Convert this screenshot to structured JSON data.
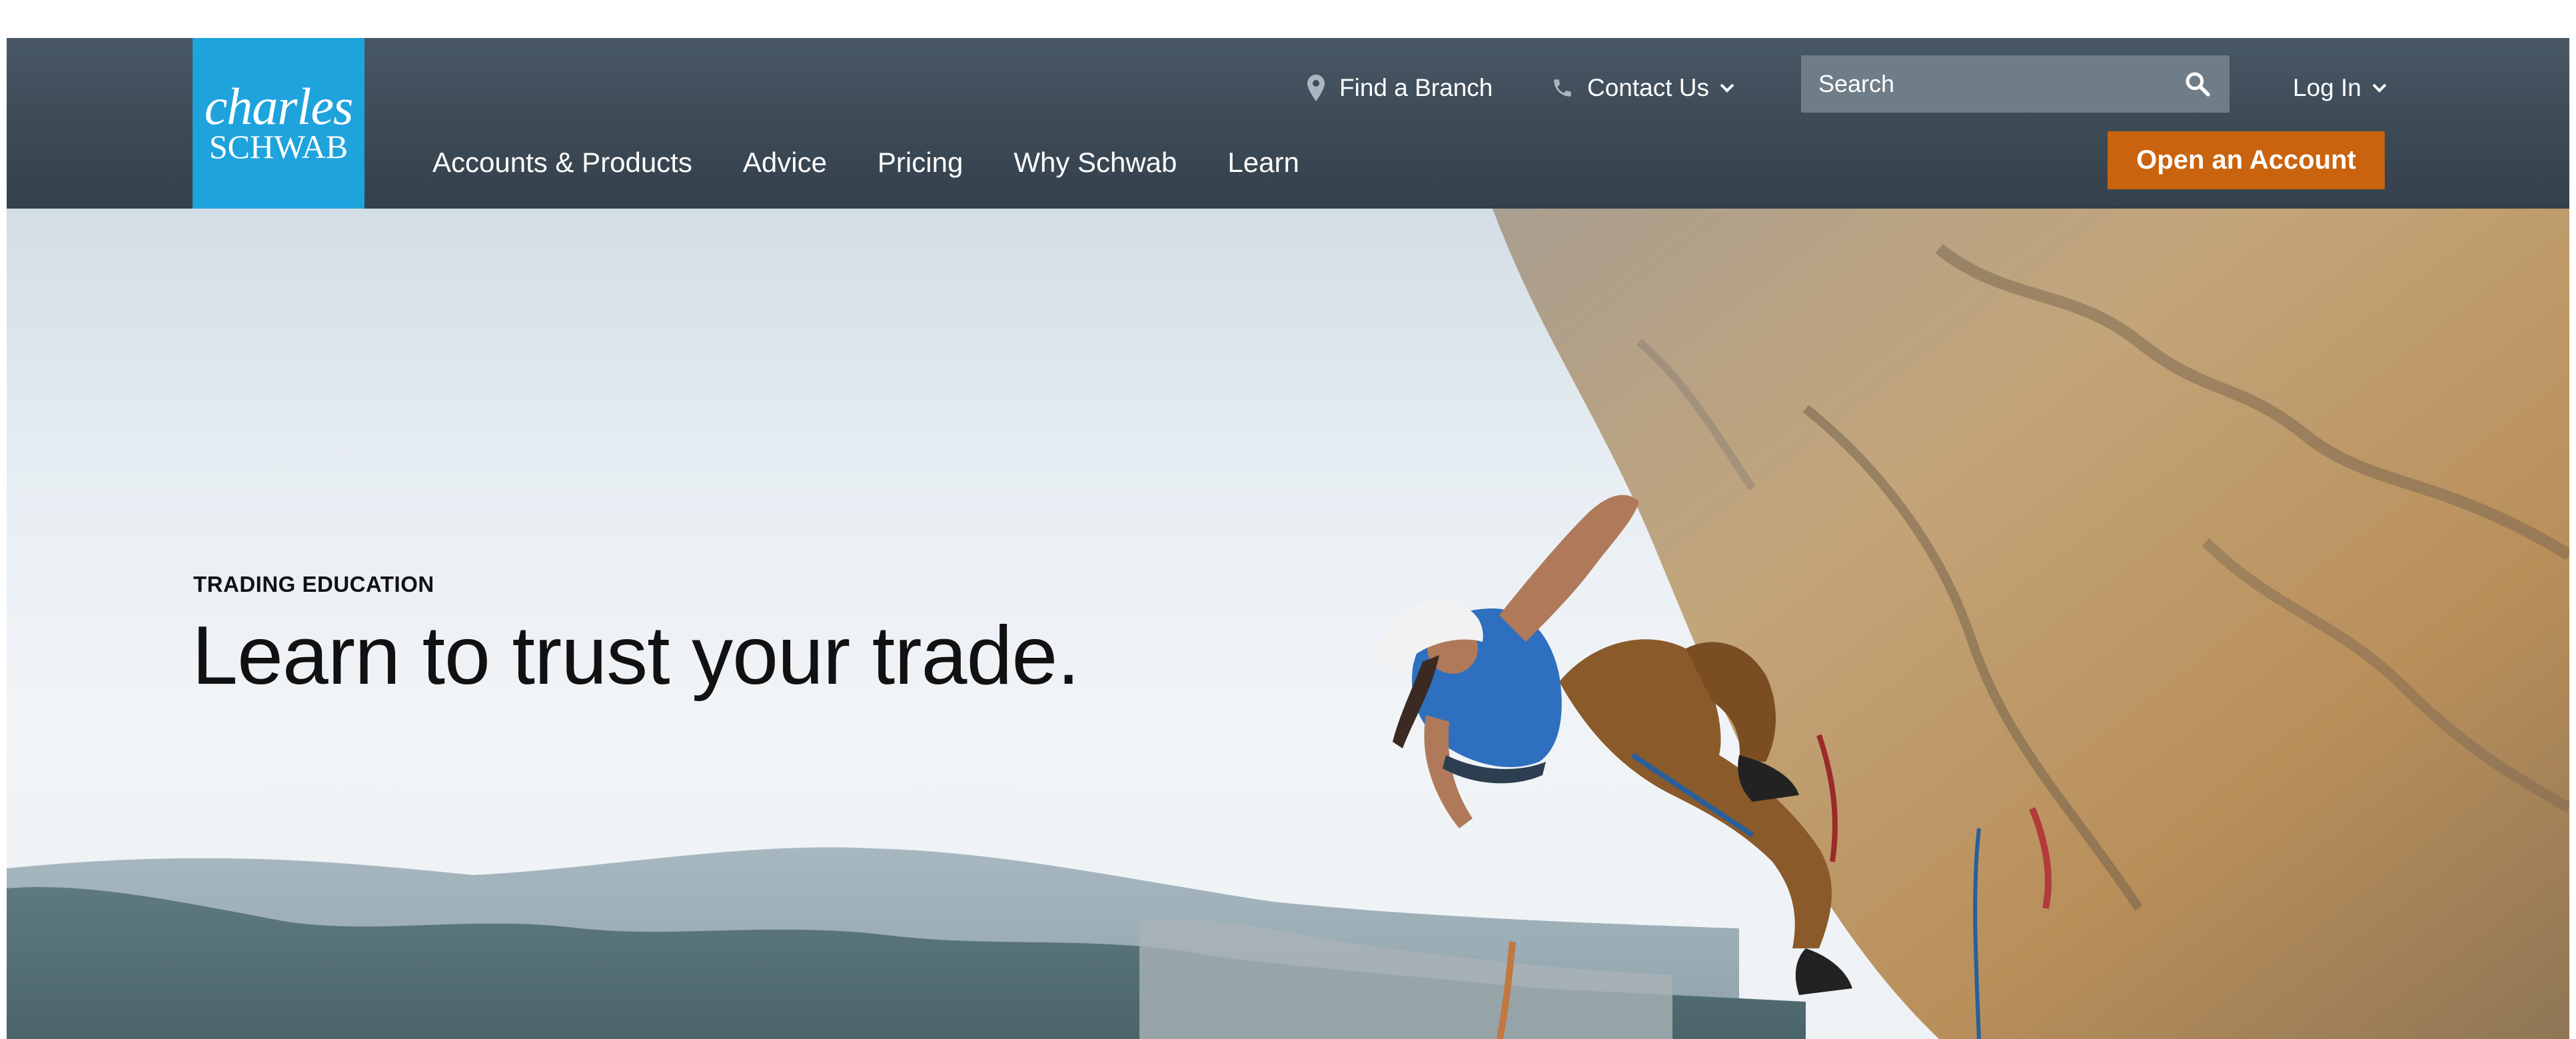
{
  "brand": {
    "logo_line1": "charles",
    "logo_line2": "SCHWAB",
    "logo_color": "#1ea3dd",
    "header_color": "#3c4a56",
    "cta_color": "#c9630d"
  },
  "utility_nav": {
    "find_branch": {
      "label": "Find a Branch",
      "icon": "map-pin-icon"
    },
    "contact_us": {
      "label": "Contact Us",
      "icon": "phone-icon"
    },
    "search": {
      "placeholder": "Search",
      "icon": "search-icon"
    },
    "login": {
      "label": "Log In"
    }
  },
  "main_nav": {
    "items": [
      {
        "label": "Accounts & Products"
      },
      {
        "label": "Advice"
      },
      {
        "label": "Pricing"
      },
      {
        "label": "Why Schwab"
      },
      {
        "label": "Learn"
      }
    ]
  },
  "cta": {
    "label": "Open an Account"
  },
  "hero": {
    "eyebrow": "TRADING EDUCATION",
    "headline": "Learn to trust your trade."
  }
}
